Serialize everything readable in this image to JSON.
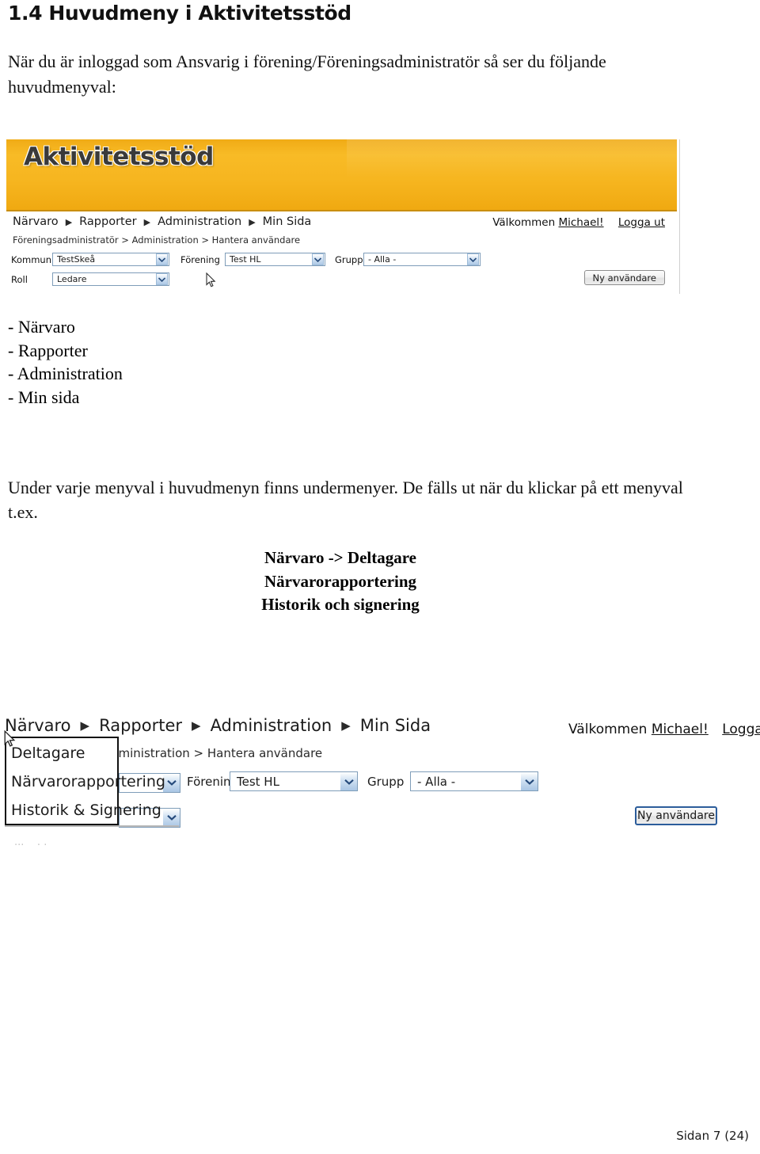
{
  "document": {
    "heading": "1.4 Huvudmeny i Aktivitetsstöd",
    "intro_paragraph": "När du är inloggad som Ansvarig i förening/Föreningsadministratör så ser du följande huvudmenyval:",
    "menu_bullets": [
      "- Närvaro",
      "- Rapporter",
      "- Administration",
      "- Min sida"
    ],
    "mid_paragraph": "Under varje menyval i huvudmenyn finns undermenyer. De fälls ut när du klickar på ett menyval t.ex.",
    "example_lines": [
      "Närvaro -> Deltagare",
      "Närvarorapportering",
      "Historik och signering"
    ],
    "footer": "Sidan 7 (24)"
  },
  "screenshot_1": {
    "brand": {
      "logo_text": "Aktivitetsstöd",
      "banner_color": "#f5b31e",
      "banner_border_color": "#c98e10"
    },
    "nav": {
      "items": [
        "Närvaro",
        "Rapporter",
        "Administration",
        "Min Sida"
      ],
      "separator_icon": "triangle-right-icon"
    },
    "user": {
      "welcome_text": "Välkommen",
      "username": "Michael!",
      "logout_label": "Logga ut"
    },
    "breadcrumb": "Föreningsadministratör > Administration > Hantera användare",
    "filters": [
      {
        "label": "Kommun",
        "value": "TestSkeå"
      },
      {
        "label": "Förening",
        "value": "Test HL"
      },
      {
        "label": "Grupp",
        "value": "- Alla -"
      },
      {
        "label": "Roll",
        "value": "Ledare"
      }
    ],
    "new_user_button": "Ny användare",
    "cursor_icon": "mouse-pointer-icon"
  },
  "screenshot_2": {
    "nav": {
      "items": [
        "Närvaro",
        "Rapporter",
        "Administration",
        "Min Sida"
      ],
      "separator_icon": "triangle-right-icon"
    },
    "user": {
      "welcome_text": "Välkommen",
      "username": "Michael!",
      "logout_label": "Logga ut"
    },
    "breadcrumb": "dministration > Hantera användare",
    "dropdown": {
      "parent": "Närvaro",
      "items": [
        "Deltagare",
        "Närvarorapportering",
        "Historik & Signering"
      ]
    },
    "filters": [
      {
        "label": "Förening",
        "value": "Test HL"
      },
      {
        "label": "Grupp",
        "value": "- Alla -"
      }
    ],
    "new_user_button": "Ny användare",
    "cursor_icon": "mouse-pointer-icon"
  }
}
